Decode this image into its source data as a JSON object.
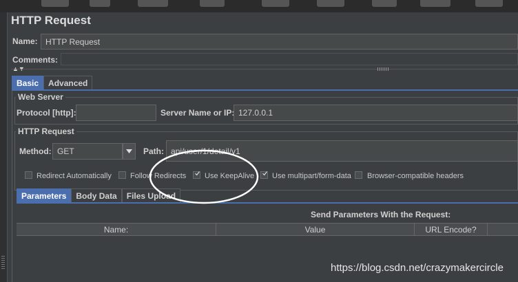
{
  "panel_title": "HTTP Request",
  "name_field": {
    "label": "Name:",
    "value": "HTTP Request"
  },
  "comments": {
    "label": "Comments:"
  },
  "tabs": [
    {
      "label": "Basic",
      "selected": true
    },
    {
      "label": "Advanced",
      "selected": false
    }
  ],
  "web_server": {
    "legend": "Web Server",
    "protocol_label": "Protocol [http]:",
    "protocol_value": "",
    "server_label": "Server Name or IP:",
    "server_value": "127.0.0.1"
  },
  "http_request": {
    "legend": "HTTP Request",
    "method_label": "Method:",
    "method_value": "GET",
    "path_label": "Path:",
    "path_value": "api/user/1/detail/v1"
  },
  "options": [
    {
      "label": "Redirect Automatically",
      "checked": false
    },
    {
      "label": "Follow Redirects",
      "checked": false
    },
    {
      "label": "Use KeepAlive",
      "checked": true
    },
    {
      "label": "Use multipart/form-data",
      "checked": true
    },
    {
      "label": "Browser-compatible headers",
      "checked": false
    }
  ],
  "param_tabs": [
    {
      "label": "Parameters",
      "selected": true
    },
    {
      "label": "Body Data",
      "selected": false
    },
    {
      "label": "Files Upload",
      "selected": false
    }
  ],
  "params_table": {
    "title": "Send Parameters With the Request:",
    "columns": [
      "Name:",
      "Value",
      "URL Encode?"
    ]
  },
  "watermark": "https://blog.csdn.net/crazymakercircle",
  "colors": {
    "selected_tab": "#4b6eaf",
    "background": "#3c3f41",
    "annotation": "#ffffff"
  }
}
